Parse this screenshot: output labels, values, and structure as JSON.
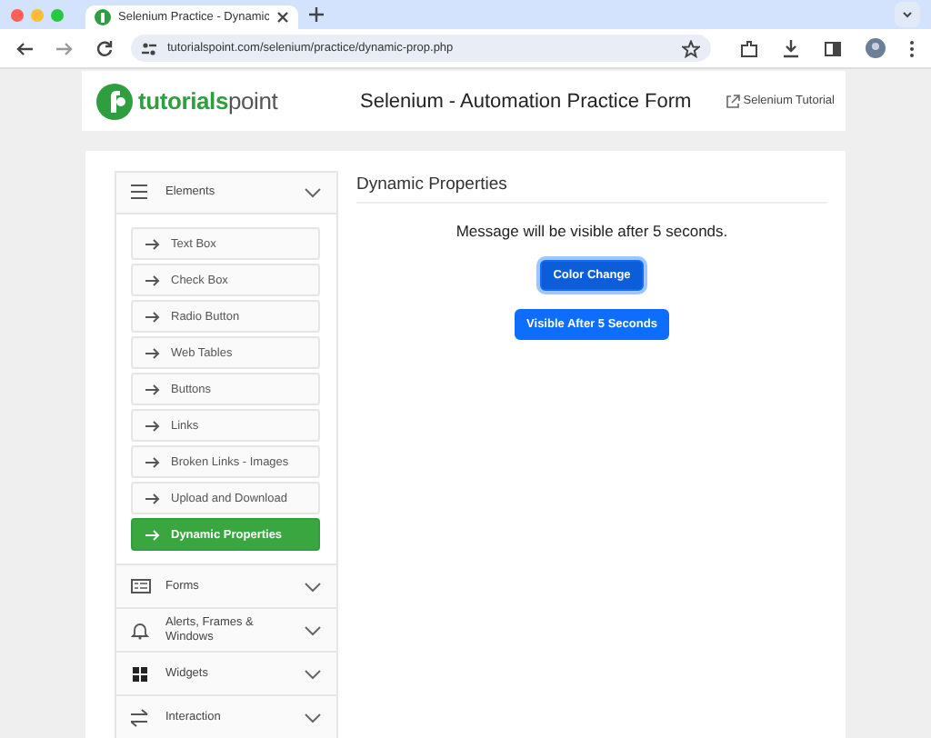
{
  "browser": {
    "tab_title": "Selenium Practice - Dynamic",
    "url": "tutorialspoint.com/selenium/practice/dynamic-prop.php"
  },
  "header": {
    "logo_text": "tutorials",
    "logo_text_2": "point",
    "title": "Selenium - Automation Practice Form",
    "link": "Selenium Tutorial"
  },
  "sidebar": {
    "sections": [
      {
        "label": "Elements",
        "expanded": true,
        "items": [
          {
            "label": "Text Box",
            "selected": false
          },
          {
            "label": "Check Box",
            "selected": false
          },
          {
            "label": "Radio Button",
            "selected": false
          },
          {
            "label": "Web Tables",
            "selected": false
          },
          {
            "label": "Buttons",
            "selected": false
          },
          {
            "label": "Links",
            "selected": false
          },
          {
            "label": "Broken Links - Images",
            "selected": false
          },
          {
            "label": "Upload and Download",
            "selected": false
          },
          {
            "label": "Dynamic Properties",
            "selected": true
          }
        ]
      },
      {
        "label": "Forms",
        "expanded": false
      },
      {
        "label": "Alerts, Frames & Windows",
        "expanded": false
      },
      {
        "label": "Widgets",
        "expanded": false
      },
      {
        "label": "Interaction",
        "expanded": false
      }
    ]
  },
  "content": {
    "title": "Dynamic Properties",
    "message": "Message will be visible after 5 seconds.",
    "buttons": [
      {
        "label": "Color Change",
        "focused": true
      },
      {
        "label": "Visible After 5 Seconds",
        "focused": false
      }
    ]
  }
}
